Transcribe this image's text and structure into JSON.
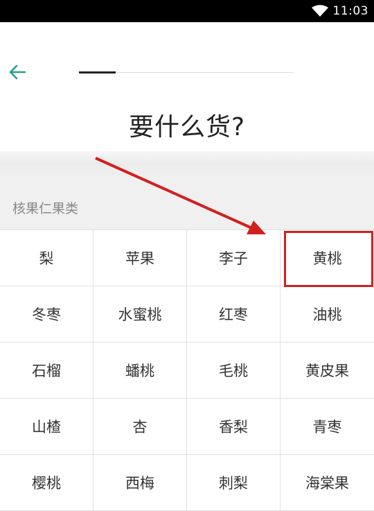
{
  "status_bar": {
    "time": "11:03",
    "wifi_icon": "wifi-icon"
  },
  "header": {
    "back_icon": "arrow-left-icon",
    "title": "要什么货?",
    "progress_fraction": 0.17,
    "accent_color": "#25a186"
  },
  "section": {
    "label": "核果仁果类",
    "items": [
      "梨",
      "苹果",
      "李子",
      "黄桃",
      "冬枣",
      "水蜜桃",
      "红枣",
      "油桃",
      "石榴",
      "蟠桃",
      "毛桃",
      "黄皮果",
      "山楂",
      "杏",
      "香梨",
      "青枣",
      "樱桃",
      "西梅",
      "刺梨",
      "海棠果"
    ]
  },
  "annotation": {
    "highlight_color": "#d21f1f"
  }
}
